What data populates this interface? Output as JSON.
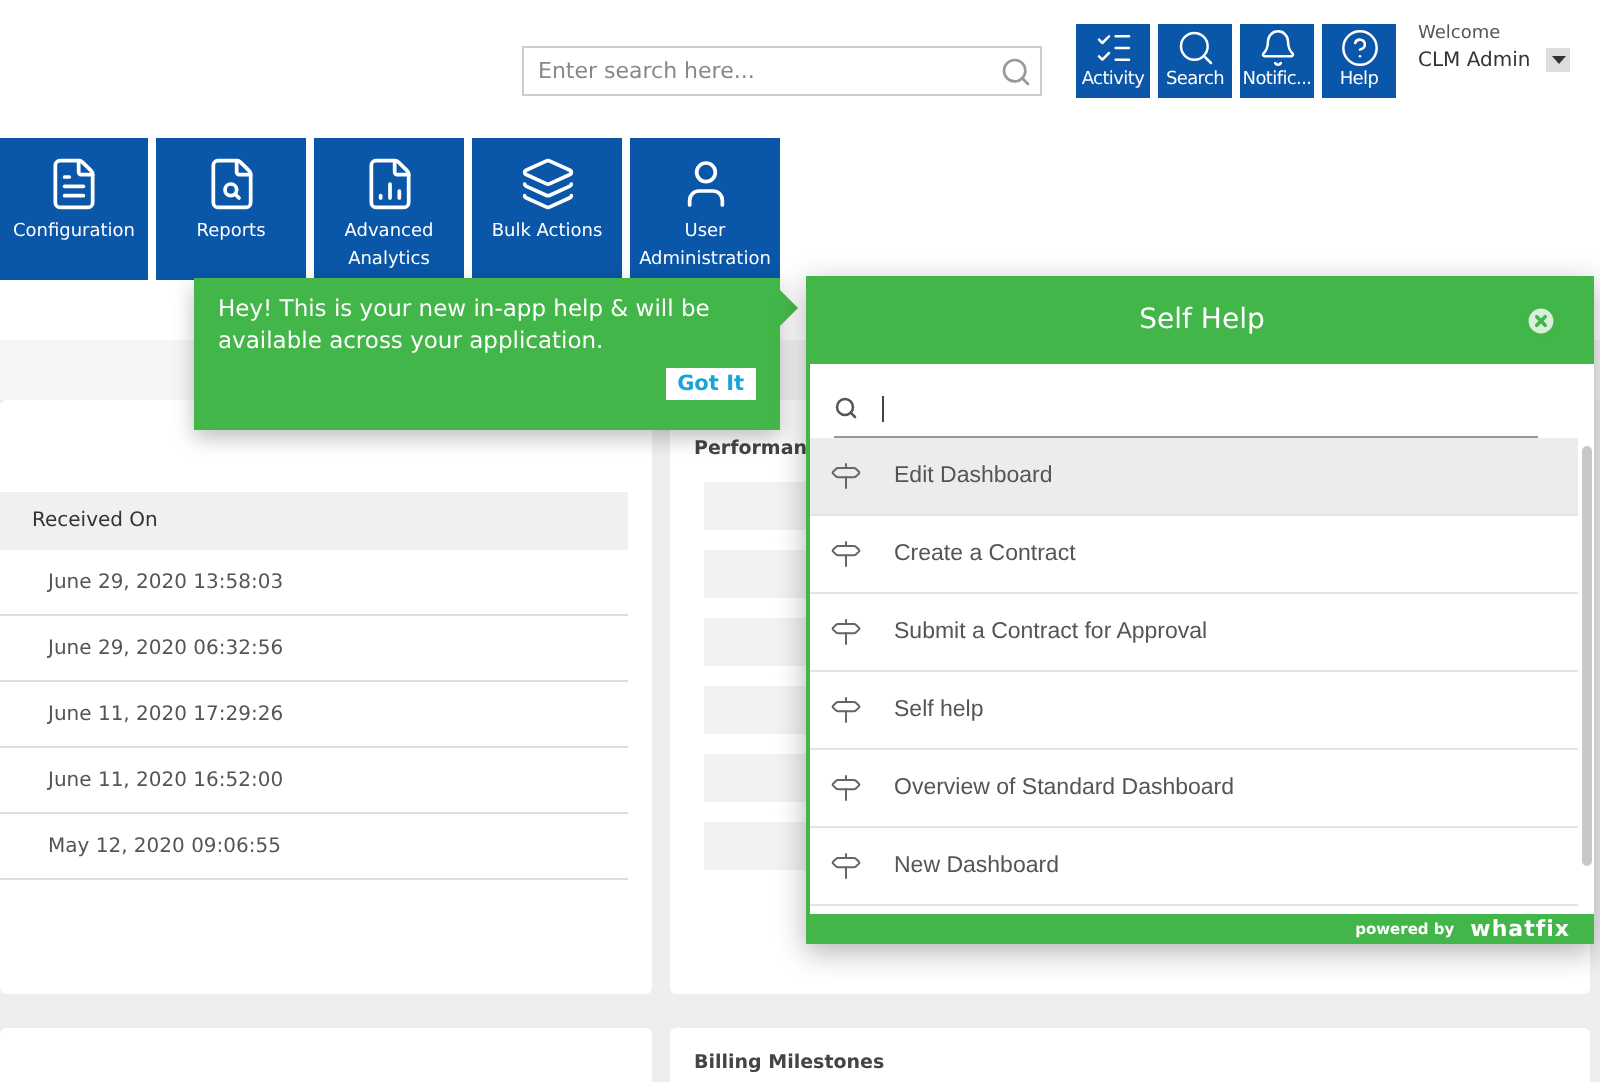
{
  "header": {
    "search": {
      "placeholder": "Enter search here..."
    },
    "quick_actions": [
      {
        "label": "Activity"
      },
      {
        "label": "Search"
      },
      {
        "label": "Notific..."
      },
      {
        "label": "Help"
      }
    ],
    "user": {
      "greeting": "Welcome",
      "name": "CLM Admin"
    }
  },
  "modules": [
    {
      "label": "Configuration"
    },
    {
      "label": "Reports"
    },
    {
      "label": "Advanced Analytics"
    },
    {
      "label": "Bulk Actions"
    },
    {
      "label": "User Administration"
    }
  ],
  "table": {
    "columns": [
      "Received On"
    ],
    "rows": [
      [
        "June 29, 2020 13:58:03"
      ],
      [
        "June 29, 2020 06:32:56"
      ],
      [
        "June 11, 2020 17:29:26"
      ],
      [
        "June 11, 2020 16:52:00"
      ],
      [
        "May 12, 2020 09:06:55"
      ]
    ]
  },
  "performance_panel": {
    "title": "Performan"
  },
  "billing_panel": {
    "title": "Billing Milestones"
  },
  "tooltip": {
    "text": "Hey! This is your new in-app help & will be available across your application.",
    "button": "Got It"
  },
  "self_help": {
    "title": "Self Help",
    "items": [
      {
        "label": "Edit Dashboard",
        "selected": true
      },
      {
        "label": "Create a Contract",
        "selected": false
      },
      {
        "label": "Submit a Contract for Approval",
        "selected": false
      },
      {
        "label": "Self help",
        "selected": false
      },
      {
        "label": "Overview of Standard Dashboard",
        "selected": false
      },
      {
        "label": "New Dashboard",
        "selected": false
      }
    ],
    "footer": {
      "prefix": "powered by",
      "brand": "whatfix"
    }
  }
}
